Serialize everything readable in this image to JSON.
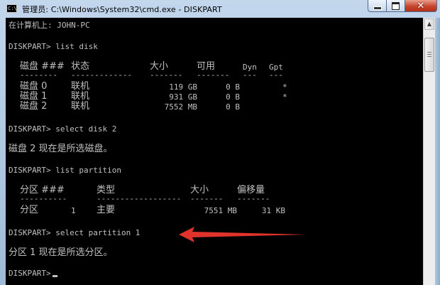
{
  "window": {
    "icon_text": "C:\\",
    "title": "管理员: C:\\Windows\\System32\\cmd.exe - DISKPART",
    "minimize_label": "minimize",
    "maximize_label": "maximize",
    "close_label": "✕"
  },
  "console": {
    "computer_line": "在计算机上: JOHN-PC",
    "cmd_list_disk": "DISKPART> list disk",
    "disk_table": {
      "headers": [
        "磁盘 ###",
        "状态",
        "大小",
        "可用",
        "Dyn",
        "Gpt"
      ],
      "separators": [
        "--------",
        "-------------",
        "-------",
        "-------",
        "---",
        "---"
      ],
      "rows": [
        [
          "磁盘 0",
          "联机",
          "119 GB",
          "0 B",
          "",
          "*"
        ],
        [
          "磁盘 1",
          "联机",
          "931 GB",
          "0 B",
          "",
          "*"
        ],
        [
          "磁盘 2",
          "联机",
          "7552 MB",
          "0 B",
          "",
          ""
        ]
      ]
    },
    "cmd_select_disk": "DISKPART> select disk 2",
    "select_disk_result": "磁盘 2 现在是所选磁盘。",
    "cmd_list_partition": "DISKPART> list partition",
    "partition_table": {
      "headers": [
        "分区 ###",
        "类型",
        "大小",
        "偏移量"
      ],
      "separators": [
        "----------",
        "------------------",
        "-------",
        "-------"
      ],
      "rows": [
        [
          "分区",
          "1",
          "主要",
          "7551 MB",
          "31 KB"
        ]
      ]
    },
    "cmd_select_partition": "DISKPART> select partition 1",
    "select_partition_result": "分区 1 现在是所选分区。",
    "prompt": "DISKPART>"
  },
  "colors": {
    "console_background": "#000000",
    "console_text": "#c0c0c0",
    "annotation_arrow": "#e0332b"
  }
}
